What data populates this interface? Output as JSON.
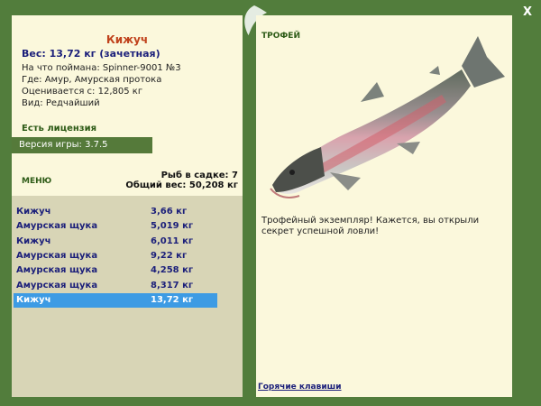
{
  "window": {
    "close_label": "X"
  },
  "catch": {
    "fish_name": "Кижуч",
    "weight_line": "Вес: 13,72 кг (зачетная)",
    "details": [
      "На что поймана: Spinner-9001 №3",
      "Где: Амур, Амурская протока",
      "Оценивается с: 12,805 кг",
      "Вид: Редчайший"
    ]
  },
  "license_text": "Есть лицензия",
  "version_text": "Версия игры: 3.7.5",
  "menu_label": "МЕНЮ",
  "cage": {
    "count_line": "Рыб в садке: 7",
    "total_line": "Общий вес: 50,208 кг"
  },
  "fish_list": [
    {
      "name": "Кижуч",
      "weight": "3,66 кг"
    },
    {
      "name": "Амурская щука",
      "weight": "5,019 кг"
    },
    {
      "name": "Кижуч",
      "weight": "6,011 кг"
    },
    {
      "name": "Амурская щука",
      "weight": "9,22 кг"
    },
    {
      "name": "Амурская щука",
      "weight": "4,258 кг"
    },
    {
      "name": "Амурская щука",
      "weight": "8,317 кг"
    },
    {
      "name": "Кижуч",
      "weight": "13,72 кг",
      "selected": true
    }
  ],
  "trophy": {
    "label": "ТРОФЕЙ",
    "text": "Трофейный экземпляр! Кажется, вы открыли секрет успешной ловли!"
  },
  "hotkeys_label": "Горячие клавиши",
  "colors": {
    "frame_green": "#527d3c",
    "panel_cream": "#fbf8dc",
    "list_bg": "#d8d5b6",
    "selected_row": "#3d9be4",
    "title_orange": "#c0421c",
    "text_navy": "#1b1f7a"
  }
}
